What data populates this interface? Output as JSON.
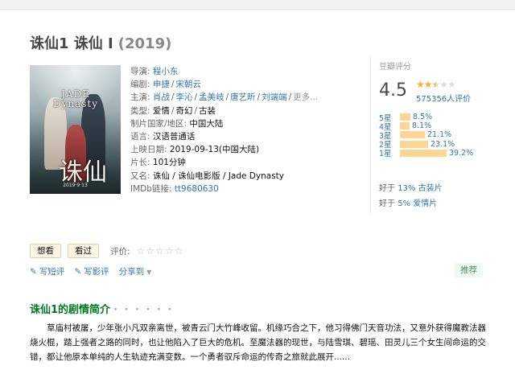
{
  "title": "诛仙1 诛仙 Ⅰ",
  "year": "(2019)",
  "poster": {
    "logo_text": "JADE\nDynasty",
    "big_char": "诛仙",
    "date_text": "2019·9·13"
  },
  "info": {
    "director_label": "导演:",
    "director": "程小东",
    "writer_label": "编剧:",
    "writers": [
      "申捷",
      "宋朝云"
    ],
    "cast_label": "主演:",
    "cast": [
      "肖战",
      "李沁",
      "孟美岐",
      "唐艺昕",
      "刘端端"
    ],
    "cast_more": "更多...",
    "genre_label": "类型:",
    "genres": [
      "爱情",
      "奇幻",
      "古装"
    ],
    "country_label": "制片国家/地区:",
    "country": "中国大陆",
    "language_label": "语言:",
    "language": "汉语普通话",
    "release_label": "上映日期:",
    "release": "2019-09-13(中国大陆)",
    "runtime_label": "片长:",
    "runtime": "101分钟",
    "aka_label": "又名:",
    "aka": "诛仙 / 诛仙电影版 / Jade Dynasty",
    "imdb_label": "IMDb链接:",
    "imdb": "tt9680630"
  },
  "rating": {
    "label": "豆瓣评分",
    "score": "4.5",
    "votes": "575356人评价",
    "stars_filled": 2.5,
    "distribution": [
      {
        "label": "5星",
        "pct": "8.5%",
        "value": 8.5
      },
      {
        "label": "4星",
        "pct": "8.1%",
        "value": 8.1
      },
      {
        "label": "3星",
        "pct": "21.1%",
        "value": 21.1
      },
      {
        "label": "2星",
        "pct": "23.1%",
        "value": 23.1
      },
      {
        "label": "1星",
        "pct": "39.2%",
        "value": 39.2
      }
    ],
    "better_1_prefix": "好于",
    "better_1_link": "13% 古装片",
    "better_2_prefix": "好于",
    "better_2_link": "5% 爱情片"
  },
  "actions": {
    "want": "想看",
    "seen": "看过",
    "rate_label": "评价:",
    "stars_empty": "☆☆☆☆☆"
  },
  "links": {
    "write_short": "写短评",
    "write_review": "写影评",
    "share": "分享到",
    "recommend": "推荐"
  },
  "summary": {
    "title": "诛仙1的剧情简介",
    "dots": "· · · · · ·",
    "text": "草庙村被屠，少年张小凡双亲离世，被青云门大竹峰收留。机缘巧合之下，他习得佛门天音功法，又意外获得魔教法器烧火棍，踏上强者之路的同时，也让他陷入了巨大的危机。至魔法器的现世，与陆雪琪、碧瑶、田灵儿三个女生间命运的交错，都让他原本单纯的人生轨迹充满变数。一个勇者驭斥命运的传奇之旅就此展开......"
  },
  "colors": {
    "link": "#3377aa",
    "green": "#007722",
    "star": "#ffac2d",
    "bar": "#ffd596"
  }
}
